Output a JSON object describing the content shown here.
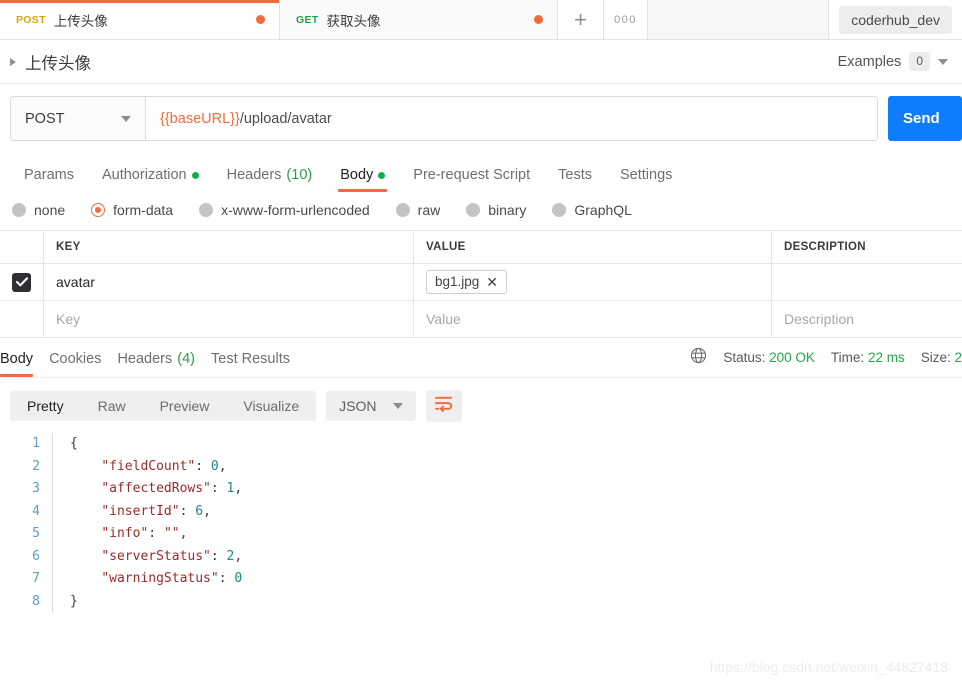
{
  "tabs": [
    {
      "method": "POST",
      "name": "上传头像",
      "active": true,
      "unsaved": true
    },
    {
      "method": "GET",
      "name": "获取头像",
      "active": false,
      "unsaved": true
    }
  ],
  "tabbar": {
    "new_tab_label": "+",
    "more_label": "000",
    "environment": "coderhub_dev"
  },
  "request_header": {
    "title": "上传头像",
    "examples_label": "Examples",
    "examples_count": "0"
  },
  "url_bar": {
    "method": "POST",
    "url_variable": "{{baseURL}}",
    "url_path": "/upload/avatar",
    "send_label": "Send"
  },
  "request_tabs": [
    {
      "label": "Params",
      "dot": false,
      "count": "",
      "active": false
    },
    {
      "label": "Authorization",
      "dot": true,
      "count": "",
      "active": false
    },
    {
      "label": "Headers",
      "dot": false,
      "count": "(10)",
      "active": false
    },
    {
      "label": "Body",
      "dot": true,
      "count": "",
      "active": true
    },
    {
      "label": "Pre-request Script",
      "dot": false,
      "count": "",
      "active": false
    },
    {
      "label": "Tests",
      "dot": false,
      "count": "",
      "active": false
    },
    {
      "label": "Settings",
      "dot": false,
      "count": "",
      "active": false
    }
  ],
  "body_types": [
    {
      "label": "none",
      "selected": false
    },
    {
      "label": "form-data",
      "selected": true
    },
    {
      "label": "x-www-form-urlencoded",
      "selected": false
    },
    {
      "label": "raw",
      "selected": false
    },
    {
      "label": "binary",
      "selected": false
    },
    {
      "label": "GraphQL",
      "selected": false
    }
  ],
  "form_table": {
    "headers": {
      "key": "KEY",
      "value": "VALUE",
      "description": "DESCRIPTION"
    },
    "rows": [
      {
        "checked": true,
        "key": "avatar",
        "value_file": "bg1.jpg",
        "description": ""
      }
    ],
    "placeholder_row": {
      "key": "Key",
      "value": "Value",
      "description": "Description"
    }
  },
  "response_tabs": [
    {
      "label": "Body",
      "count": "",
      "active": true
    },
    {
      "label": "Cookies",
      "count": "",
      "active": false
    },
    {
      "label": "Headers",
      "count": "(4)",
      "active": false
    },
    {
      "label": "Test Results",
      "count": "",
      "active": false
    }
  ],
  "response_meta": {
    "status_label": "Status:",
    "status_value": "200 OK",
    "time_label": "Time:",
    "time_value": "22 ms",
    "size_label": "Size:",
    "size_value": "2"
  },
  "view_bar": {
    "modes": [
      {
        "label": "Pretty",
        "active": true
      },
      {
        "label": "Raw",
        "active": false
      },
      {
        "label": "Preview",
        "active": false
      },
      {
        "label": "Visualize",
        "active": false
      }
    ],
    "language": "JSON"
  },
  "response_body": {
    "lines": [
      {
        "n": "1",
        "indent": 0,
        "tokens": [
          {
            "t": "{",
            "c": "brace"
          }
        ]
      },
      {
        "n": "2",
        "indent": 4,
        "tokens": [
          {
            "t": "\"fieldCount\"",
            "c": "key"
          },
          {
            "t": ": ",
            "c": "punc"
          },
          {
            "t": "0",
            "c": "num"
          },
          {
            "t": ",",
            "c": "punc"
          }
        ]
      },
      {
        "n": "3",
        "indent": 4,
        "tokens": [
          {
            "t": "\"affectedRows\"",
            "c": "key"
          },
          {
            "t": ": ",
            "c": "punc"
          },
          {
            "t": "1",
            "c": "num"
          },
          {
            "t": ",",
            "c": "punc"
          }
        ]
      },
      {
        "n": "4",
        "indent": 4,
        "tokens": [
          {
            "t": "\"insertId\"",
            "c": "key"
          },
          {
            "t": ": ",
            "c": "punc"
          },
          {
            "t": "6",
            "c": "num"
          },
          {
            "t": ",",
            "c": "punc"
          }
        ]
      },
      {
        "n": "5",
        "indent": 4,
        "tokens": [
          {
            "t": "\"info\"",
            "c": "key"
          },
          {
            "t": ": ",
            "c": "punc"
          },
          {
            "t": "\"\"",
            "c": "str"
          },
          {
            "t": ",",
            "c": "punc"
          }
        ]
      },
      {
        "n": "6",
        "indent": 4,
        "tokens": [
          {
            "t": "\"serverStatus\"",
            "c": "key"
          },
          {
            "t": ": ",
            "c": "punc"
          },
          {
            "t": "2",
            "c": "num"
          },
          {
            "t": ",",
            "c": "punc"
          }
        ]
      },
      {
        "n": "7",
        "indent": 4,
        "tokens": [
          {
            "t": "\"warningStatus\"",
            "c": "key"
          },
          {
            "t": ": ",
            "c": "punc"
          },
          {
            "t": "0",
            "c": "num"
          }
        ]
      },
      {
        "n": "8",
        "indent": 0,
        "tokens": [
          {
            "t": "}",
            "c": "brace"
          }
        ]
      }
    ]
  },
  "watermark": "https://blog.csdn.net/weixin_44827418",
  "colors": {
    "accent_orange": "#f26b3a",
    "send_blue": "#0d7dfc",
    "status_green": "#21a84a",
    "method_post": "#d9a404",
    "method_get": "#2a9d48"
  }
}
